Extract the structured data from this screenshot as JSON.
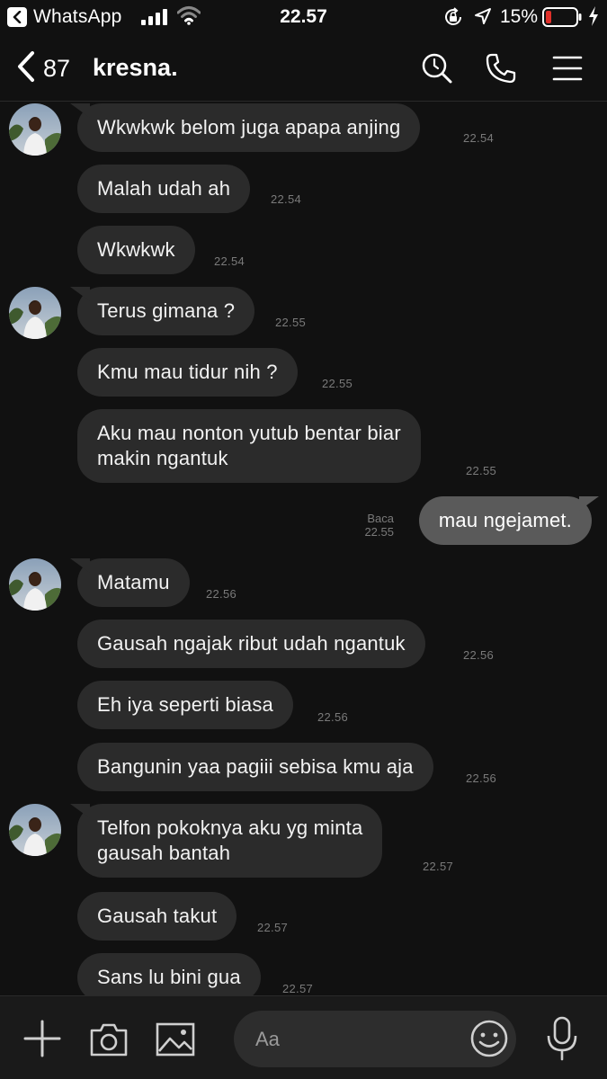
{
  "status_bar": {
    "back_app": "WhatsApp",
    "time": "22.57",
    "battery_pct": "15%",
    "icons": [
      "back-app-icon",
      "signal-icon",
      "wifi-icon",
      "orientation-lock-icon",
      "location-icon",
      "battery-icon",
      "charging-icon"
    ]
  },
  "header": {
    "back_count": "87",
    "title": "kresna.",
    "icons": [
      "back-chevron-icon",
      "search-icon",
      "call-icon",
      "menu-icon"
    ]
  },
  "messages": [
    {
      "text": "Wkwkwk belom juga apapa anjing",
      "time": "22.54",
      "direction": "received"
    },
    {
      "text": "Malah udah ah",
      "time": "22.54",
      "direction": "received"
    },
    {
      "text": "Wkwkwk",
      "time": "22.54",
      "direction": "received"
    },
    {
      "text": "Terus gimana ?",
      "time": "22.55",
      "direction": "received"
    },
    {
      "text": "Kmu mau tidur nih ?",
      "time": "22.55",
      "direction": "received"
    },
    {
      "text": "Aku mau nonton yutub bentar biar\nmakin ngantuk",
      "time": "22.55",
      "direction": "received"
    },
    {
      "text": "mau ngejamet.",
      "time": "22.55",
      "direction": "sent",
      "read": "Baca"
    },
    {
      "text": "Matamu",
      "time": "22.56",
      "direction": "received"
    },
    {
      "text": "Gausah ngajak ribut udah ngantuk",
      "time": "22.56",
      "direction": "received"
    },
    {
      "text": "Eh iya seperti biasa",
      "time": "22.56",
      "direction": "received"
    },
    {
      "text": "Bangunin yaa pagiii sebisa kmu aja",
      "time": "22.56",
      "direction": "received"
    },
    {
      "text": "Telfon pokoknya aku yg minta\ngausah bantah",
      "time": "22.57",
      "direction": "received"
    },
    {
      "text": "Gausah takut",
      "time": "22.57",
      "direction": "received"
    },
    {
      "text": "Sans lu bini gua",
      "time": "22.57",
      "direction": "received"
    }
  ],
  "composer": {
    "placeholder": "Aa",
    "icons": [
      "plus-icon",
      "camera-icon",
      "image-icon",
      "emoji-icon",
      "microphone-icon"
    ]
  },
  "colors": {
    "background": "#111111",
    "received_bubble": "#2b2b2b",
    "sent_bubble": "#5a5a5a",
    "timestamp": "#7a7a7a",
    "battery_low": "#e0302a"
  }
}
